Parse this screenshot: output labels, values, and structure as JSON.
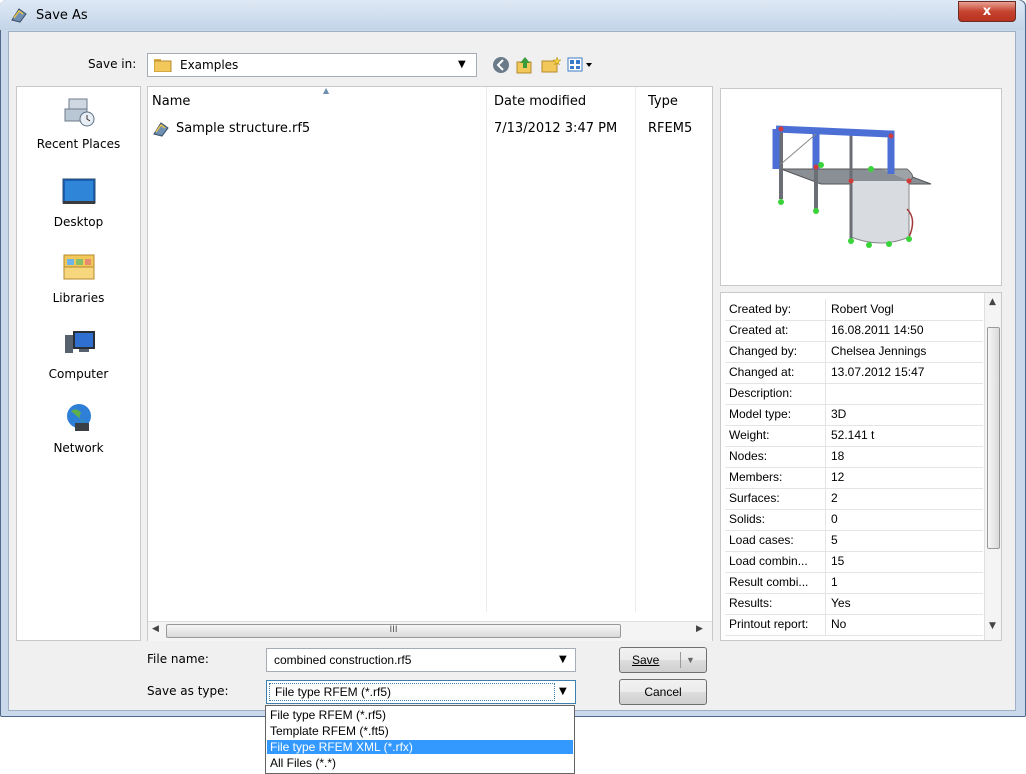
{
  "window": {
    "title": "Save As",
    "close_label": "x"
  },
  "toolbar": {
    "save_in_label": "Save in:",
    "save_in_value": "Examples"
  },
  "places": [
    {
      "label": "Recent Places",
      "icon": "recent-places-icon"
    },
    {
      "label": "Desktop",
      "icon": "desktop-icon"
    },
    {
      "label": "Libraries",
      "icon": "libraries-icon"
    },
    {
      "label": "Computer",
      "icon": "computer-icon"
    },
    {
      "label": "Network",
      "icon": "network-icon"
    }
  ],
  "file_list": {
    "columns": [
      "Name",
      "Date modified",
      "Type"
    ],
    "rows": [
      {
        "name": "Sample structure.rf5",
        "date": "7/13/2012 3:47 PM",
        "type": "RFEM5"
      }
    ],
    "hscroll_grip": "III"
  },
  "info": [
    {
      "key": "Created by:",
      "value": "Robert Vogl"
    },
    {
      "key": "Created at:",
      "value": "16.08.2011 14:50"
    },
    {
      "key": "Changed by:",
      "value": "Chelsea Jennings"
    },
    {
      "key": "Changed at:",
      "value": "13.07.2012 15:47"
    },
    {
      "key": "Description:",
      "value": ""
    },
    {
      "key": "Model type:",
      "value": "3D"
    },
    {
      "key": "Weight:",
      "value": "52.141 t"
    },
    {
      "key": "Nodes:",
      "value": "18"
    },
    {
      "key": "Members:",
      "value": "12"
    },
    {
      "key": "Surfaces:",
      "value": "2"
    },
    {
      "key": "Solids:",
      "value": "0"
    },
    {
      "key": "Load cases:",
      "value": "5"
    },
    {
      "key": "Load combin...",
      "value": "15"
    },
    {
      "key": "Result combi...",
      "value": "1"
    },
    {
      "key": "Results:",
      "value": "Yes"
    },
    {
      "key": "Printout report:",
      "value": "No"
    }
  ],
  "form": {
    "file_name_label": "File name:",
    "file_name_value": "combined construction.rf5",
    "save_type_label": "Save as type:",
    "save_type_value": "File type RFEM (*.rf5)",
    "save_button": "Save",
    "cancel_button": "Cancel",
    "type_options": [
      "File type RFEM (*.rf5)",
      "Template RFEM (*.ft5)",
      "File type RFEM XML (*.rfx)",
      "All Files (*.*)"
    ],
    "highlighted_option_index": 2
  },
  "colors": {
    "selection": "#3399ff",
    "close_button": "#c5432f",
    "frame": "#c9d8ea"
  }
}
